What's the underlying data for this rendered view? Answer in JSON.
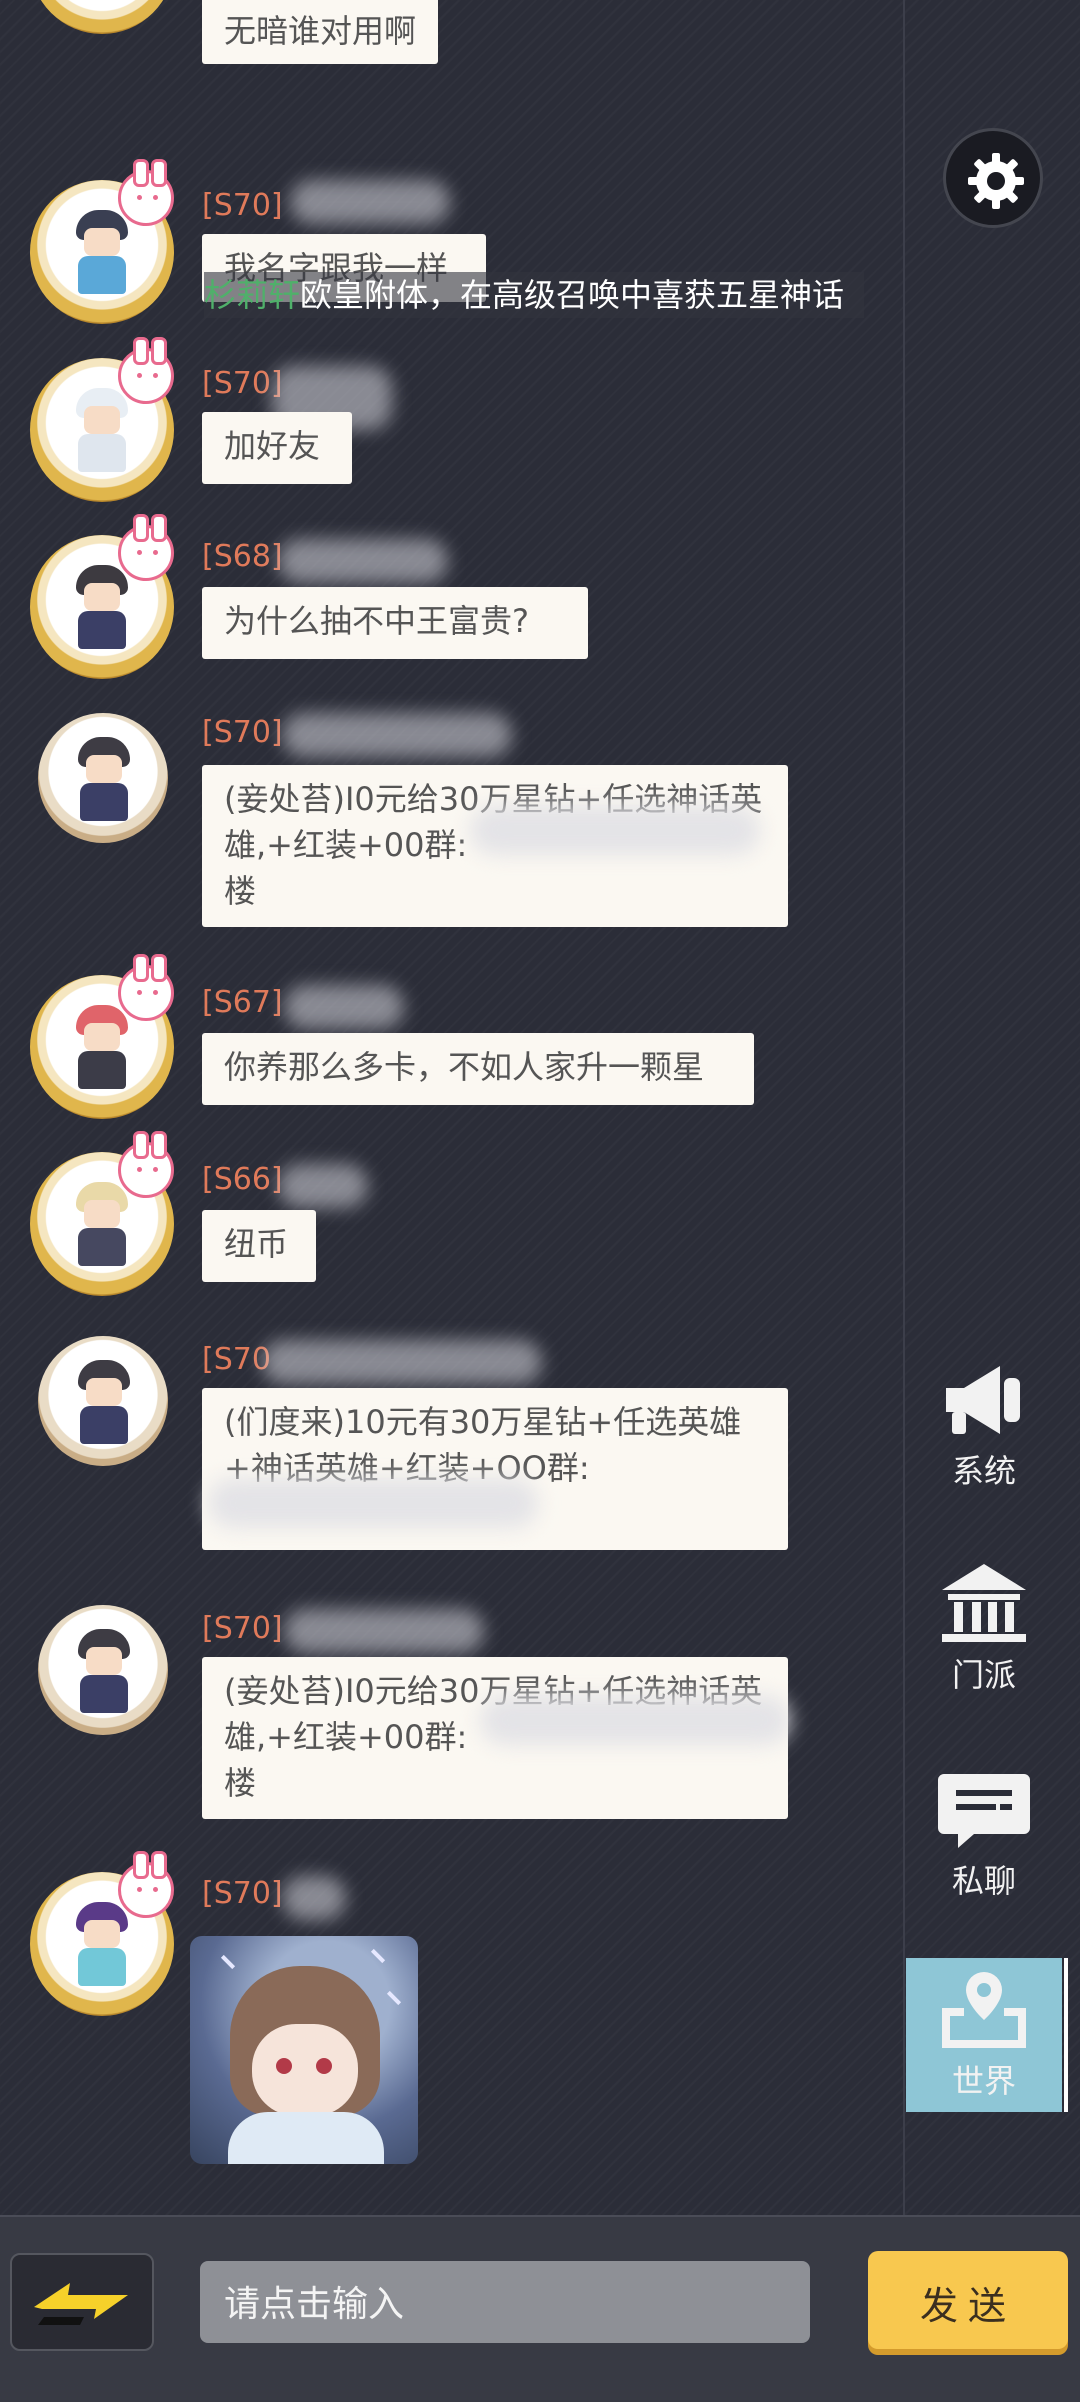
{
  "chat": {
    "top_partial_text": "无暗谁对用啊",
    "messages": [
      {
        "server": "[S70]",
        "text": "我名字跟我一样",
        "type": "text"
      },
      {
        "server": "[S70]",
        "text": "加好友",
        "type": "text"
      },
      {
        "server": "[S68]",
        "text": "为什么抽不中王富贵?",
        "type": "text"
      },
      {
        "server": "[S70]",
        "text": "(妾处苔)I0元给30万星钻+任选神话英雄,+红装+00群:\n楼",
        "type": "text"
      },
      {
        "server": "[S67]",
        "text": "你养那么多卡，不如人家升一颗星",
        "type": "text"
      },
      {
        "server": "[S66]",
        "text": "纽币",
        "type": "text"
      },
      {
        "server": "[S70",
        "text": "(们度来)10元有30万星钻+任选英雄+神话英雄+红装+OO群:\n",
        "type": "text"
      },
      {
        "server": "[S70]",
        "text": "(妾处苔)I0元给30万星钻+任选神话英雄,+红装+00群:\n楼",
        "type": "text"
      },
      {
        "server": "[S70]",
        "text": "",
        "type": "sticker"
      }
    ],
    "ticker": {
      "name": "杉莉轩",
      "text": "欧皇附体，在高级召唤中喜获五星神话"
    }
  },
  "sidebar": {
    "settings_icon": "gear-icon",
    "items": [
      {
        "label": "系统",
        "icon": "megaphone-icon"
      },
      {
        "label": "门派",
        "icon": "temple-icon"
      },
      {
        "label": "私聊",
        "icon": "chat-bubble-icon"
      },
      {
        "label": "世界",
        "icon": "world-pin-icon",
        "active": true
      }
    ]
  },
  "bottom": {
    "input_placeholder": "请点击输入",
    "send_label": "发送",
    "swap_icon": "lightning-swap-icon",
    "emoji_icon": "emoji-face-icon"
  },
  "colors": {
    "background": "#2b2d38",
    "server_tag": "#e07a5a",
    "bubble": "#fbf8f2",
    "active_tab": "#8ec6d6",
    "send_button": "#f8c84f",
    "ticker_name": "#4fb06a"
  }
}
